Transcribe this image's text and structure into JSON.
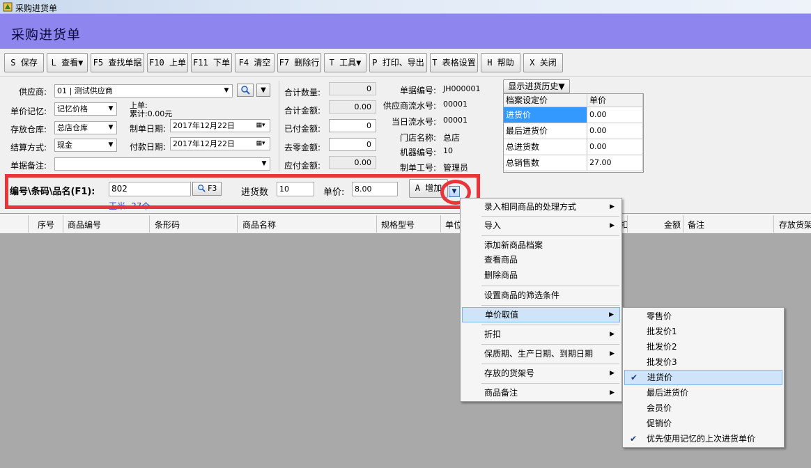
{
  "window": {
    "title": "采购进货单"
  },
  "header": {
    "title": "采购进货单"
  },
  "toolbar": {
    "save": "S 保存",
    "view": "L 查看▼",
    "find": "F5 查找单据",
    "prev": "F10 上单",
    "next": "F11 下单",
    "clear": "F4 清空",
    "delete_row": "F7 删除行",
    "tools": "T 工具▼",
    "print": "P 打印、导出",
    "table_settings": "T 表格设置",
    "help": "H 帮助",
    "close": "X 关闭"
  },
  "form": {
    "supplier_label": "供应商:",
    "supplier_value": "01 | 测试供应商",
    "price_memory_label": "单价记忆:",
    "price_memory_value": "记忆价格",
    "last_order_label": "上单:",
    "last_total": "累计:0.00元",
    "warehouse_label": "存放仓库:",
    "warehouse_value": "总店仓库",
    "create_date_label": "制单日期:",
    "create_date_value": "2017年12月22日",
    "settlement_label": "结算方式:",
    "settlement_value": "现金",
    "pay_date_label": "付款日期:",
    "pay_date_value": "2017年12月22日",
    "remark_label": "单据备注:",
    "remark_value": ""
  },
  "totals": {
    "qty_label": "合计数量:",
    "qty_value": "0",
    "amount_label": "合计金额:",
    "amount_value": "0.00",
    "paid_label": "已付金额:",
    "paid_value": "0",
    "rounding_label": "去零金额:",
    "rounding_value": "0",
    "payable_label": "应付金额:",
    "payable_value": "0.00"
  },
  "info": {
    "doc_no_label": "单据编号:",
    "doc_no_value": "JH000001",
    "supplier_serial_label": "供应商流水号:",
    "supplier_serial_value": "00001",
    "day_serial_label": "当日流水号:",
    "day_serial_value": "00001",
    "store_label": "门店名称:",
    "store_value": "总店",
    "machine_label": "机器编号:",
    "machine_value": "10",
    "operator_label": "制单工号:",
    "operator_value": "管理员"
  },
  "history": {
    "toggle_label": "显示进货历史▼",
    "col_setting": "档案设定价",
    "col_price": "单价",
    "rows": [
      {
        "name": "进货价",
        "value": "0.00"
      },
      {
        "name": "最后进货价",
        "value": "0.00"
      },
      {
        "name": "总进货数",
        "value": "0.00"
      },
      {
        "name": "总销售数",
        "value": "27.00"
      }
    ]
  },
  "entry": {
    "code_label": "编号\\条码\\品名(F1):",
    "code_value": "802",
    "search_button": "F3",
    "qty_label": "进货数",
    "qty_value": "10",
    "price_label": "单价:",
    "price_value": "8.00",
    "add_button": "A 增加",
    "item_hint": "玉米 -27个"
  },
  "table": {
    "columns": [
      "序号",
      "商品编号",
      "条形码",
      "商品名称",
      "规格型号",
      "单位",
      "扣",
      "金额",
      "备注",
      "存放货架"
    ]
  },
  "context_menu": {
    "items": [
      {
        "label": "录入相同商品的处理方式",
        "submenu": true
      },
      {
        "label": "导入",
        "submenu": true
      },
      {
        "label": "添加新商品档案",
        "submenu": false
      },
      {
        "label": "查看商品",
        "submenu": false
      },
      {
        "label": "删除商品",
        "submenu": false
      },
      {
        "label": "设置商品的筛选条件",
        "submenu": false
      },
      {
        "label": "单价取值",
        "submenu": true
      },
      {
        "label": "折扣",
        "submenu": true
      },
      {
        "label": "保质期、生产日期、到期日期",
        "submenu": true
      },
      {
        "label": "存放的货架号",
        "submenu": true
      },
      {
        "label": "商品备注",
        "submenu": true
      }
    ]
  },
  "price_submenu": {
    "items": [
      {
        "label": "零售价",
        "checked": false
      },
      {
        "label": "批发价1",
        "checked": false
      },
      {
        "label": "批发价2",
        "checked": false
      },
      {
        "label": "批发价3",
        "checked": false
      },
      {
        "label": "进货价",
        "checked": true
      },
      {
        "label": "最后进货价",
        "checked": false
      },
      {
        "label": "会员价",
        "checked": false
      },
      {
        "label": "促销价",
        "checked": false
      },
      {
        "label": "优先使用记忆的上次进货单价",
        "checked": true
      }
    ]
  },
  "colors": {
    "header_band": "#8e85ee",
    "highlight_box": "#e8353a",
    "selected": "#3399ff",
    "menu_highlight": "#cfe4f8"
  }
}
